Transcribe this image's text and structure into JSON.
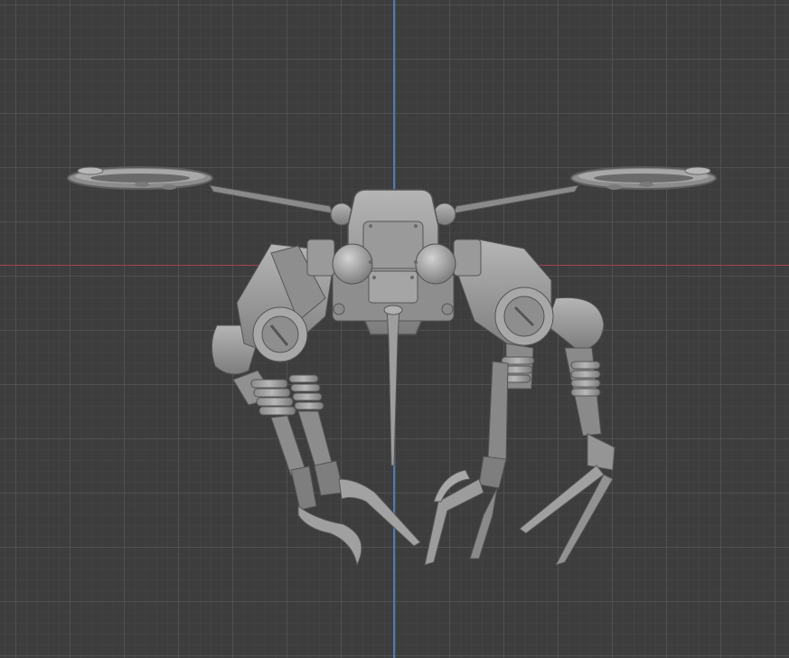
{
  "viewport": {
    "background": "#3d3d3d",
    "grid_color": "#5a5a5a"
  },
  "axes": {
    "y_axis_color": "#4a7bb5",
    "x_axis_color": "#a04450"
  },
  "model": {
    "icon": "robot-mosquito-model",
    "body_color": "#9a9a9a",
    "shade_color": "#6e6e6e",
    "highlight_color": "#c4c4c4"
  }
}
